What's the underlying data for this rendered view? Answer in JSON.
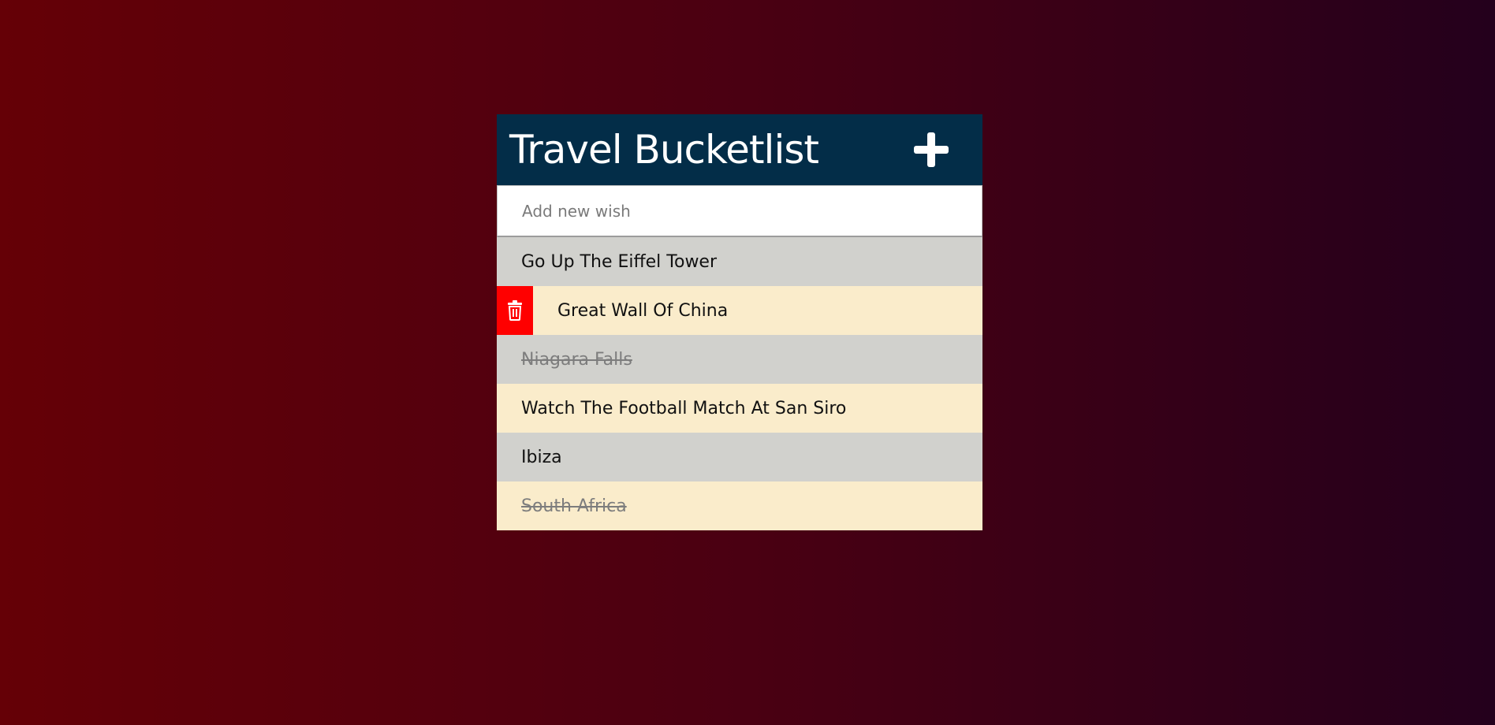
{
  "header": {
    "title": "Travel Bucketlist",
    "add_icon": "plus-icon"
  },
  "input": {
    "placeholder": "Add new wish",
    "value": ""
  },
  "items": [
    {
      "label": "Go Up The Eiffel Tower",
      "completed": false
    },
    {
      "label": "Great Wall Of China",
      "completed": false,
      "hovered": true,
      "action_icon": "trash-icon"
    },
    {
      "label": "Niagara Falls",
      "completed": true
    },
    {
      "label": "Watch The Football Match At San Siro",
      "completed": false
    },
    {
      "label": "Ibiza",
      "completed": false
    },
    {
      "label": "South Africa",
      "completed": true
    }
  ],
  "colors": {
    "header_bg": "#032d48",
    "row_gray": "#d1d1cd",
    "row_cream": "#faeccb",
    "delete_red": "#ff0000",
    "bg_left": "#650006",
    "bg_right": "#24001c"
  }
}
